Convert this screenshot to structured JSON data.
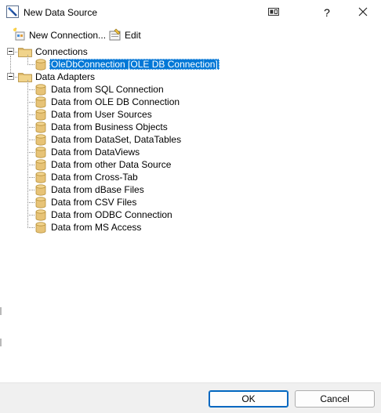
{
  "window": {
    "title": "New Data Source",
    "help_label": "?"
  },
  "toolbar": {
    "new_connection_label": "New Connection...",
    "edit_label": "Edit"
  },
  "tree": {
    "connections": {
      "label": "Connections",
      "items": [
        {
          "label": "OleDbConnection [OLE DB Connection]",
          "selected": true
        }
      ]
    },
    "data_adapters": {
      "label": "Data Adapters",
      "items": [
        {
          "label": "Data from SQL Connection"
        },
        {
          "label": "Data from OLE DB Connection"
        },
        {
          "label": "Data from User Sources"
        },
        {
          "label": "Data from Business Objects"
        },
        {
          "label": "Data from DataSet, DataTables"
        },
        {
          "label": "Data from DataViews"
        },
        {
          "label": "Data from other Data Source"
        },
        {
          "label": "Data from Cross-Tab"
        },
        {
          "label": "Data from dBase Files"
        },
        {
          "label": "Data from CSV Files"
        },
        {
          "label": "Data from ODBC Connection"
        },
        {
          "label": "Data from MS Access"
        }
      ]
    }
  },
  "buttons": {
    "ok_label": "OK",
    "cancel_label": "Cancel"
  },
  "colors": {
    "selection": "#0078d7",
    "folder": "#dcb86a",
    "database": "#e7c377"
  },
  "icons": {
    "app": "report-designer-icon",
    "restore": "restore-window-icon",
    "close": "close-icon",
    "new_connection": "new-connection-icon",
    "edit": "edit-icon",
    "folder": "folder-icon",
    "database": "database-icon"
  }
}
